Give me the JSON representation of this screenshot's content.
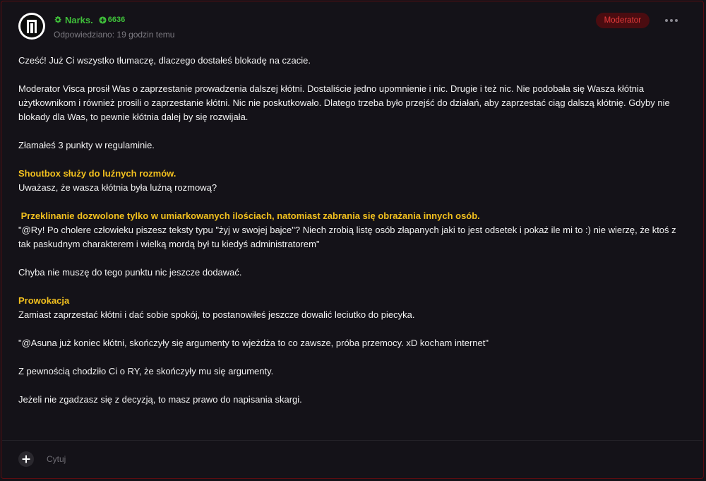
{
  "post": {
    "author": {
      "name": "Narks.",
      "reputation": "6636",
      "name_color": "#3fbf3a"
    },
    "timestamp": "Odpowiedziano: 19 godzin temu",
    "badge": "Moderator",
    "badge_color": "#e83b3b",
    "menu_icon": "more-dots-icon",
    "body": [
      {
        "text": "Cześć! Już Ci wszystko tłumaczę, dlaczego dostałeś blokadę na czacie.",
        "highlight": false
      },
      {
        "text": "",
        "highlight": false
      },
      {
        "text": "Moderator Visca prosił Was o zaprzestanie prowadzenia dalszej kłótni. Dostaliście jedno upomnienie i nic. Drugie i też nic. Nie podobała się Wasza kłótnia użytkownikom i również prosili o zaprzestanie kłótni. Nic nie poskutkowało. Dlatego trzeba było przejść do działań, aby zaprzestać ciąg dalszą kłótnię. Gdyby nie blokady dla Was, to pewnie kłótnia dalej by się rozwijała.",
        "highlight": false
      },
      {
        "text": "",
        "highlight": false
      },
      {
        "text": "Złamałeś 3 punkty w regulaminie.",
        "highlight": false
      },
      {
        "text": "",
        "highlight": false
      },
      {
        "text": "Shoutbox służy do luźnych rozmów.",
        "highlight": true
      },
      {
        "text": "Uważasz, że wasza kłótnia była luźną rozmową?",
        "highlight": false
      },
      {
        "text": "",
        "highlight": false
      },
      {
        "text": " Przeklinanie dozwolone tylko w umiarkowanych ilościach, natomiast zabrania się obrażania innych osób.",
        "highlight": true
      },
      {
        "text": "\"@Ry! Po cholere człowieku piszesz teksty typu \"żyj w swojej bajce\"? Niech zrobią listę osób złapanych jaki to jest odsetek i pokaż ile mi to :) nie wierzę, że ktoś z tak paskudnym charakterem i wielką mordą był tu kiedyś administratorem\"",
        "highlight": false
      },
      {
        "text": "",
        "highlight": false
      },
      {
        "text": "Chyba nie muszę do tego punktu nic jeszcze dodawać.",
        "highlight": false
      },
      {
        "text": "",
        "highlight": false
      },
      {
        "text": "Prowokacja",
        "highlight": true
      },
      {
        "text": "Zamiast zaprzestać kłótni i dać sobie spokój, to postanowiłeś jeszcze dowalić leciutko do piecyka.",
        "highlight": false
      },
      {
        "text": "",
        "highlight": false
      },
      {
        "text": "\"@Asuna już koniec kłótni, skończyły się argumenty to wjeżdża to co zawsze, próba przemocy. xD kocham internet\"",
        "highlight": false
      },
      {
        "text": "",
        "highlight": false
      },
      {
        "text": "Z pewnością chodziło Ci o RY, że skończyły mu się argumenty.",
        "highlight": false
      },
      {
        "text": "",
        "highlight": false
      },
      {
        "text": "Jeżeli nie zgadzasz się z decyzją, to masz prawo do napisania skargi.",
        "highlight": false
      }
    ],
    "highlight_color": "#f2c01e"
  },
  "footer": {
    "add_icon": "plus-icon",
    "quote_label": "Cytuj"
  }
}
